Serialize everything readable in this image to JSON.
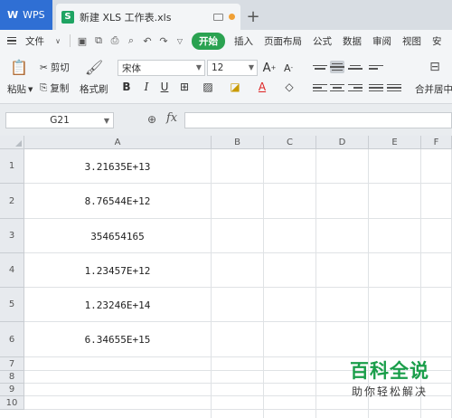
{
  "titlebar": {
    "app_tab": "WPS",
    "doc_tab": "新建 XLS 工作表.xls",
    "new_tab": "+"
  },
  "menubar": {
    "file": "文件",
    "start": "开始",
    "items": [
      "插入",
      "页面布局",
      "公式",
      "数据",
      "审阅",
      "视图",
      "安"
    ]
  },
  "ribbon": {
    "paste": "粘贴",
    "cut": "剪切",
    "copy": "复制",
    "format_painter": "格式刷",
    "font_name": "宋体",
    "font_size": "12",
    "grow_font": "A",
    "shrink_font": "A",
    "bold": "B",
    "italic": "I",
    "underline": "U",
    "merge_center": "合并居中"
  },
  "formulabar": {
    "name_box": "G21",
    "fx": "fx",
    "formula": ""
  },
  "sheet": {
    "columns": [
      "A",
      "B",
      "C",
      "D",
      "E",
      "F"
    ],
    "rows": [
      "1",
      "2",
      "3",
      "4",
      "5",
      "6",
      "7",
      "8",
      "9",
      "10"
    ],
    "cells_A": [
      "3.21635E+13",
      "8.76544E+12",
      "354654165",
      "1.23457E+12",
      "1.23246E+14",
      "6.34655E+15"
    ]
  },
  "watermark": {
    "title": "百科全说",
    "subtitle": "助你轻松解决"
  },
  "colors": {
    "wps_blue": "#2f6fd4",
    "start_green": "#2aa251",
    "xls_green": "#1fa463",
    "watermark_green": "#1a9e4a"
  }
}
